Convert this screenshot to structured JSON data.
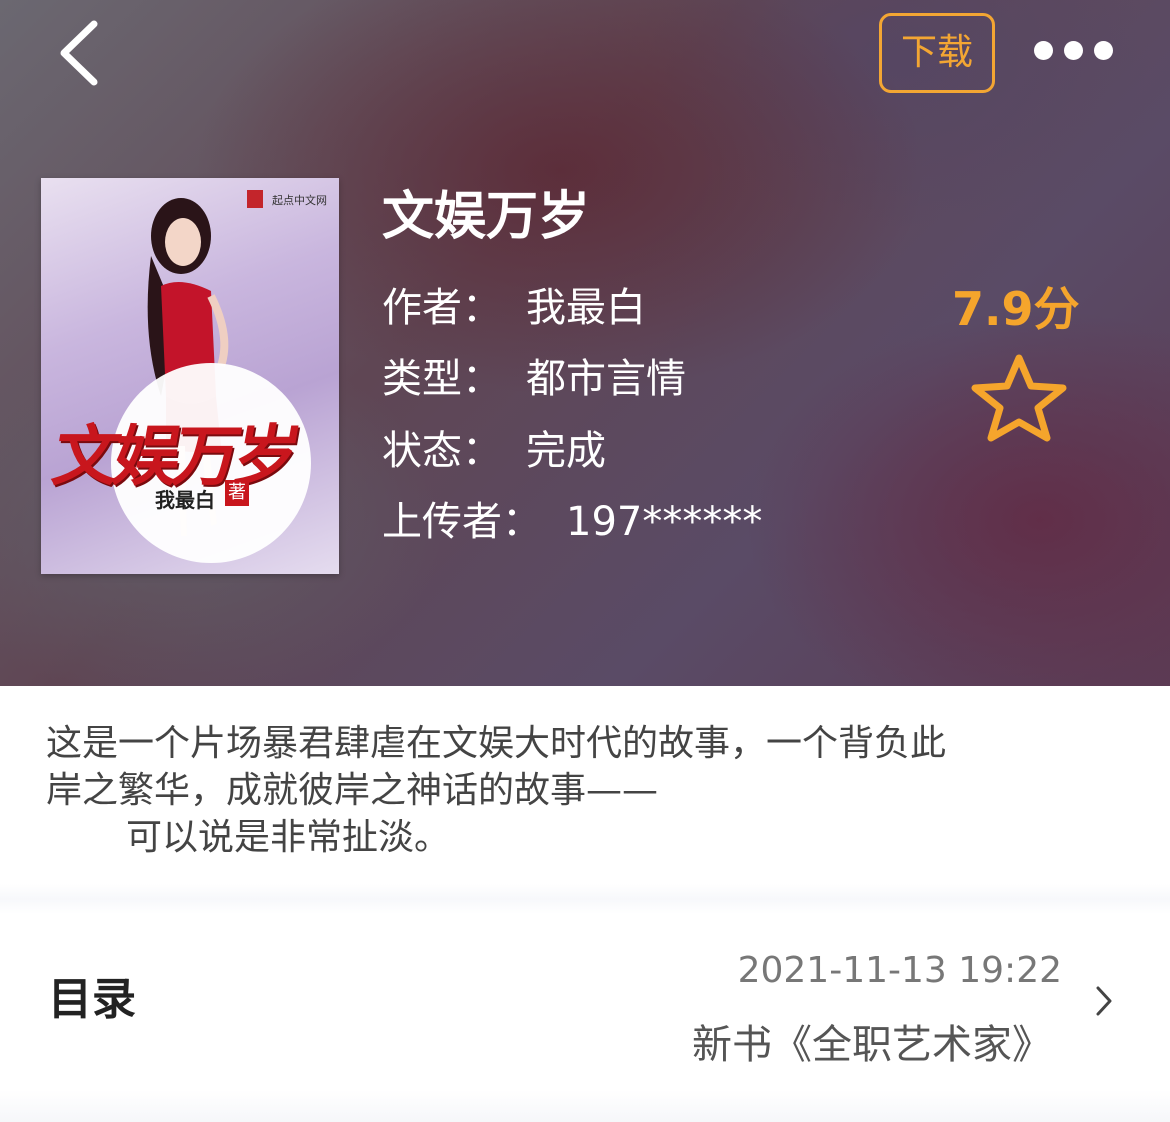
{
  "header": {
    "download_label": "下载"
  },
  "cover": {
    "title": "文娱万岁",
    "author": "我最白",
    "author_seal": "著",
    "publisher": "起点中文网"
  },
  "book": {
    "title": "文娱万岁",
    "author_label": "作者：",
    "author": "我最白",
    "genre_label": "类型：",
    "genre": "都市言情",
    "status_label": "状态：",
    "status": "完成",
    "uploader_label": "上传者：",
    "uploader": "197******",
    "rating": "7.9分"
  },
  "synopsis": {
    "line1": "这是一个片场暴君肆虐在文娱大时代的故事，一个背负此",
    "line2": "岸之繁华，成就彼岸之神话的故事——",
    "line3": "可以说是非常扯淡。"
  },
  "toc": {
    "label": "目录",
    "updated_at": "2021-11-13 19:22",
    "latest_chapter": "新书《全职艺术家》"
  },
  "colors": {
    "accent": "#f3a633",
    "rating": "#f5a52c",
    "cover_red": "#c8161d"
  },
  "icons": {
    "back": "chevron-left-icon",
    "more": "more-dots-icon",
    "star": "star-outline-icon",
    "toc_arrow": "chevron-right-icon"
  }
}
